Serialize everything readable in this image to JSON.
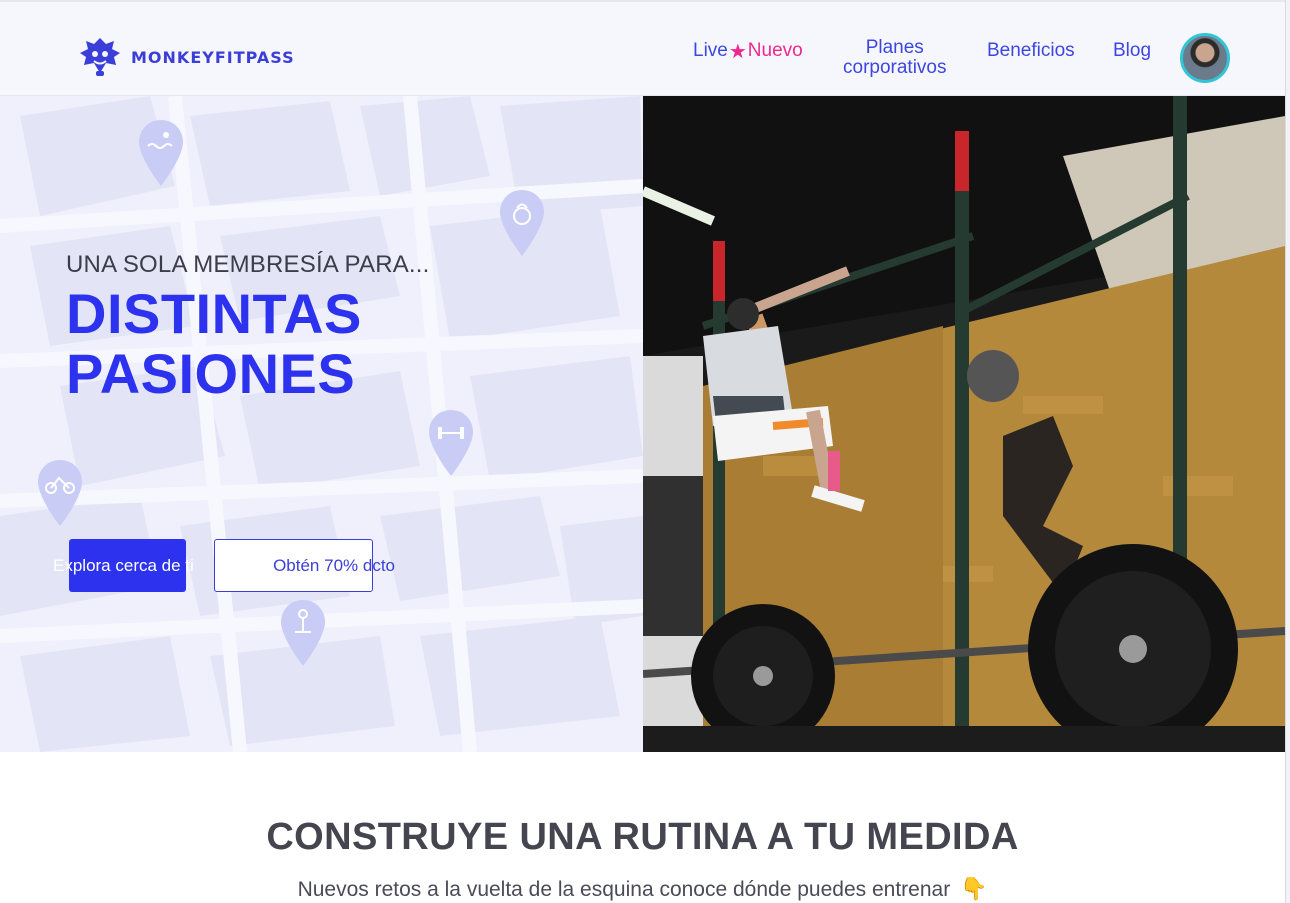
{
  "brand": {
    "name": "MONKEYFITPASS",
    "primary_color": "#2d32ee",
    "accent_color": "#f0288c"
  },
  "nav": {
    "live": "Live",
    "live_star_icon": "star-icon",
    "live_new": "Nuevo",
    "planes_line1": "Planes",
    "planes_line2": "corporativos",
    "beneficios": "Beneficios",
    "blog": "Blog"
  },
  "hero": {
    "eyebrow": "UNA SOLA MEMBRESÍA PARA...",
    "title_line1": "DISTINTAS",
    "title_line2": "PASIONES",
    "explore_button": "Explora cerca de ti",
    "discount_button": "Obtén 70% dcto"
  },
  "section": {
    "title": "CONSTRUYE UNA RUTINA A TU MEDIDA",
    "subtitle": "Nuevos retos a la vuelta de la esquina conoce dónde puedes entrenar",
    "hand_icon": "pointing-down-hand-icon"
  }
}
